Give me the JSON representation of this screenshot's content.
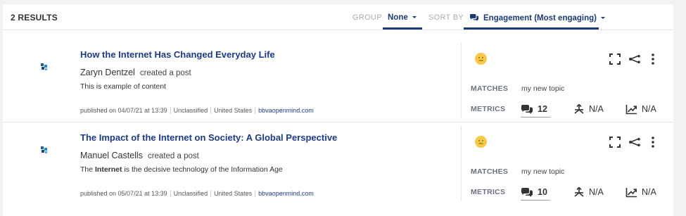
{
  "header": {
    "results_label": "2 RESULTS",
    "group_label": "GROUP",
    "group_value": "None",
    "sort_label": "SORT BY",
    "sort_value": "Engagement (Most engaging)"
  },
  "posts": [
    {
      "title": "How the Internet Has Changed Everyday Life",
      "author": "Zaryn Dentzel",
      "action": "created a post",
      "content_before": "This is example of content",
      "content_bold": "",
      "content_after": "",
      "published": "published on 04/07/21 at 13:39",
      "classification": "Unclassified",
      "country": "United States",
      "domain": "bbvaopenmind.com",
      "matches_label": "MATCHES",
      "topic": "my new topic",
      "metrics_label": "METRICS",
      "comments": "12",
      "reach": "N/A",
      "trend": "N/A"
    },
    {
      "title": "The Impact of the Internet on Society: A Global Perspective",
      "author": "Manuel Castells",
      "action": "created a post",
      "content_before": "The ",
      "content_bold": "Internet",
      "content_after": " is the decisive technology of the Information Age",
      "published": "published on 05/07/21 at 13:39",
      "classification": "Unclassified",
      "country": "United States",
      "domain": "bbvaopenmind.com",
      "matches_label": "MATCHES",
      "topic": "my new topic",
      "metrics_label": "METRICS",
      "comments": "10",
      "reach": "N/A",
      "trend": "N/A"
    }
  ],
  "colors": {
    "accent": "#1b3a7a",
    "link": "#1b3a8a",
    "sentiment_neutral": "#f7c948"
  }
}
